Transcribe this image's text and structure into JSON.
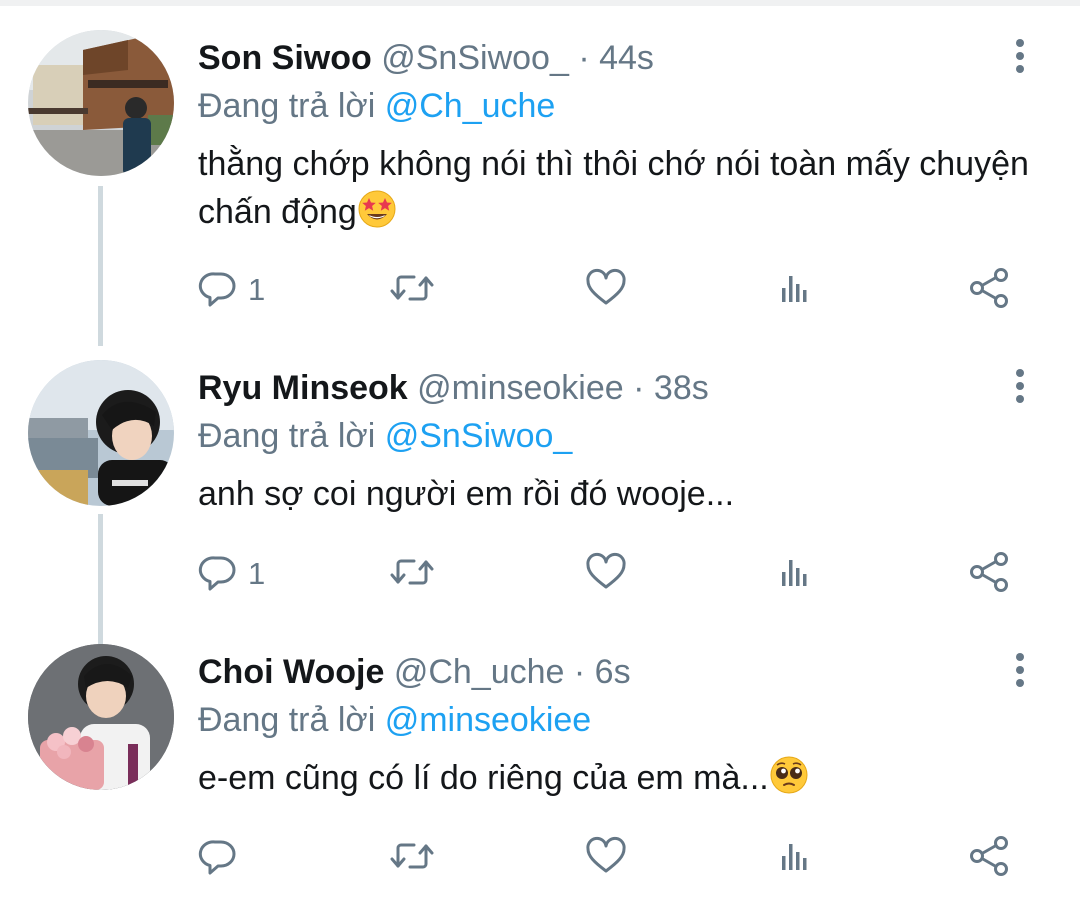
{
  "thread": [
    {
      "name": "Son Siwoo",
      "handle": "@SnSiwoo_",
      "separator": "·",
      "time": "44s",
      "replying_prefix": "Đang trả lời",
      "replying_to": "@Ch_uche",
      "text": "thằng chớp không nói thì thôi chớ nói toàn mấy chuyện chấn động",
      "emoji": "star-struck-emoji",
      "reply_count": "1",
      "avatar": "son-siwoo-avatar"
    },
    {
      "name": "Ryu Minseok",
      "handle": "@minseokiee",
      "separator": "·",
      "time": "38s",
      "replying_prefix": "Đang trả lời",
      "replying_to": "@SnSiwoo_",
      "text": "anh sợ coi người em rồi đó wooje...",
      "emoji": "",
      "reply_count": "1",
      "avatar": "ryu-minseok-avatar"
    },
    {
      "name": "Choi Wooje",
      "handle": "@Ch_uche",
      "separator": "·",
      "time": "6s",
      "replying_prefix": "Đang trả lời",
      "replying_to": "@minseokiee",
      "text": "e-em cũng có lí do riêng của em mà...",
      "emoji": "pleading-face-emoji",
      "reply_count": "",
      "avatar": "choi-wooje-avatar"
    }
  ],
  "icons": {
    "reply": "reply-icon",
    "retweet": "retweet-icon",
    "like": "like-icon",
    "analytics": "analytics-icon",
    "share": "share-icon",
    "more": "more-vertical-icon"
  },
  "colors": {
    "name": "#14171a",
    "secondary": "#657786",
    "mention": "#1da1f2",
    "thread_line": "#cfd9de"
  }
}
